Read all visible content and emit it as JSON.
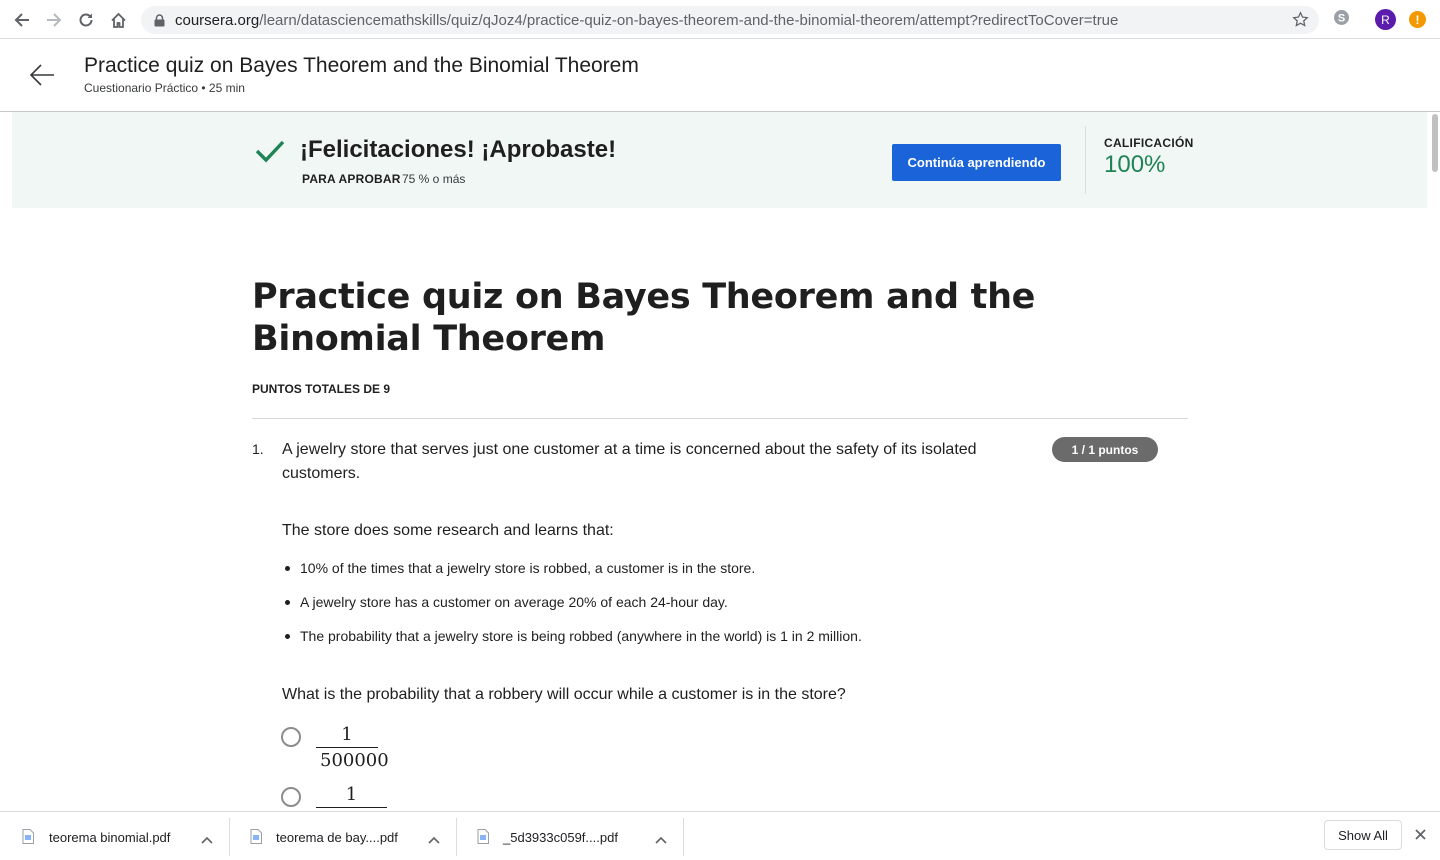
{
  "browser": {
    "url_host": "coursera.org",
    "url_path": "/learn/datasciencemathskills/quiz/qJoz4/practice-quiz-on-bayes-theorem-and-the-binomial-theorem/attempt?redirectToCover=true",
    "avatar_letter": "R",
    "update_badge": "!",
    "colors": {
      "avatar": "#5b1cae",
      "update": "#f29900"
    }
  },
  "header": {
    "title": "Practice quiz on Bayes Theorem and the Binomial Theorem",
    "subtitle": "Cuestionario Práctico • 25 min"
  },
  "banner": {
    "message": "¡Felicitaciones! ¡Aprobaste!",
    "pass_label": "PARA APROBAR",
    "pass_value": "75 % o más",
    "continue_label": "Continúa aprendiendo",
    "grade_label": "CALIFICACIÓN",
    "grade_value": "100%",
    "colors": {
      "background": "#f0f7f5",
      "check": "#1f8354",
      "button": "#1a63d8",
      "grade": "#1f8354"
    }
  },
  "quiz": {
    "title": "Practice quiz on Bayes Theorem and the Binomial Theorem",
    "total_points": "PUNTOS TOTALES DE 9"
  },
  "question1": {
    "number": "1.",
    "intro": "A jewelry store that serves just one customer at a time is concerned about the safety of its isolated customers.",
    "points": "1 / 1 puntos",
    "research_intro": "The store does some research and learns that:",
    "facts": [
      "10% of the times that a jewelry store is robbed, a customer is in the store.",
      "A jewelry store has a customer on average 20% of each 24-hour day.",
      "The probability that a jewelry store is being robbed (anywhere in the world) is 1 in 2 million."
    ],
    "prompt": "What is the probability that a robbery will occur while a customer is in the store?",
    "options": [
      {
        "numerator": "1",
        "denominator": "500000"
      },
      {
        "numerator": "1",
        "denominator": ""
      }
    ]
  },
  "downloads": {
    "items": [
      {
        "name": "teorema binomial.pdf"
      },
      {
        "name": "teorema de bay....pdf"
      },
      {
        "name": "_5d3933c059f....pdf"
      }
    ],
    "show_all": "Show All"
  }
}
